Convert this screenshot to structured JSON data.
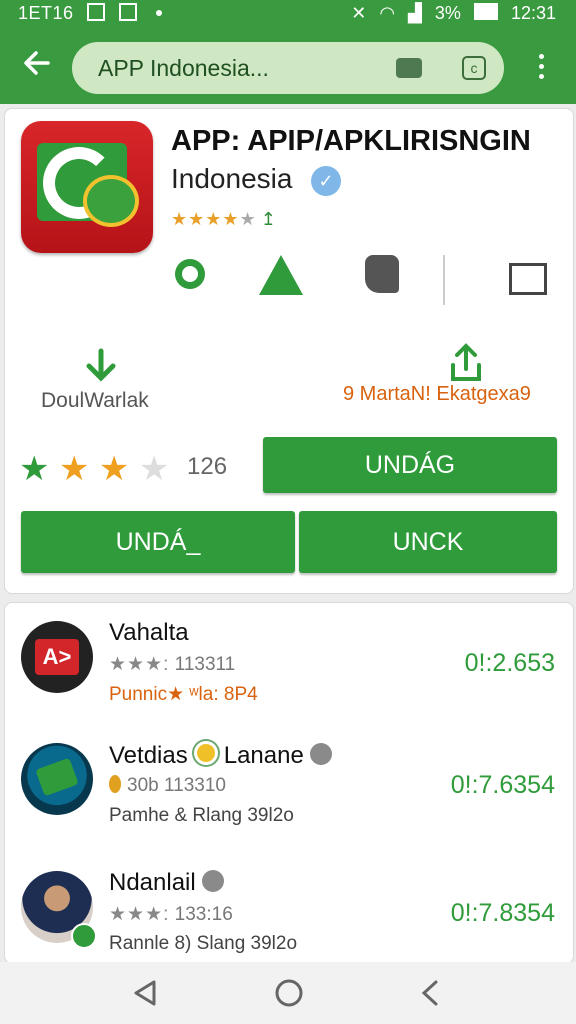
{
  "status_bar": {
    "left_text": "1ET16",
    "battery": "3%",
    "time": "12:31"
  },
  "app_bar": {
    "search_text": "APP Indonesia..."
  },
  "app": {
    "title": "APP: APIP/APKLIRISNGIN",
    "subtitle": "Indonesia",
    "mini_stars": "★★★★",
    "mini_stars_empty": "★",
    "mini_count": "↥",
    "download_label": "DoulWarlak",
    "share_label": "9 MartaN! Ekatgexa9",
    "rating_value": "126",
    "update_button": "UNDÁG",
    "button_left": "UNDÁ_",
    "button_right": "UNCK"
  },
  "list": [
    {
      "name": "Vahalta",
      "meta": "113311",
      "meta_stars": "★★★:",
      "sub": "Punnic★ ʷla: 8P4",
      "price": "0!:2.653"
    },
    {
      "name": "Vetdias",
      "name_suffix": "Lanane",
      "meta": "30b 113310",
      "sub": "Pamhe & Rlang 39l2o",
      "price": "0!:7.6354"
    },
    {
      "name": "Ndanlail",
      "meta": "133:16",
      "meta_stars": "★★★:",
      "sub": "Rannle 8) Slang 39l2o",
      "price": "0!:7.8354"
    }
  ],
  "colors": {
    "primary_green": "#3a9a3f",
    "accent_orange": "#d9620e"
  }
}
